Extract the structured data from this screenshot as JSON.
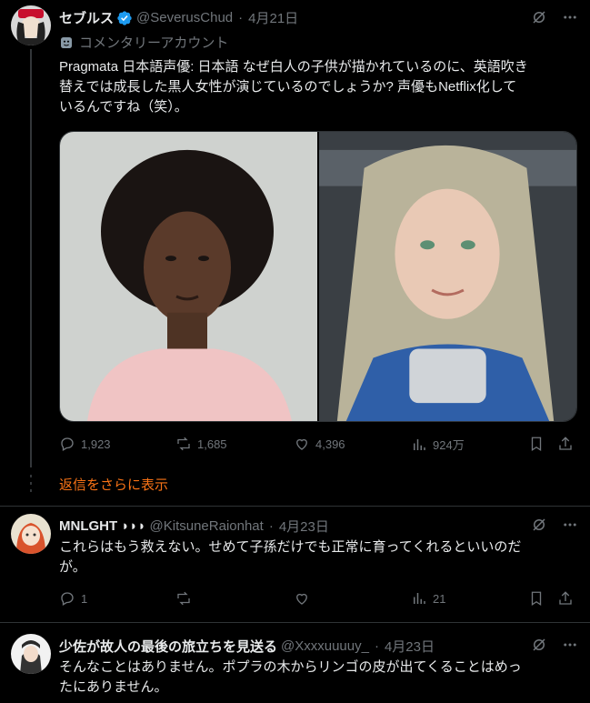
{
  "post1": {
    "name": "セブルス",
    "handle": "@SeverusChud",
    "date": "4月21日",
    "label": "コメンタリーアカウント",
    "text_line1": "Pragmata 日本語声優: 日本語 なぜ白人の子供が描かれているのに、英語吹き",
    "text_line2": "替えでは成長した黒人女性が演じているのでしょうか? 声優もNetflix化して",
    "text_line3": "いるんですね（笑）。",
    "replies": "1,923",
    "reposts": "1,685",
    "likes": "4,396",
    "views": "924万"
  },
  "show_more": "返信をさらに表示",
  "post2": {
    "name": "MNLGHT ◗◗◗",
    "handle": "@KitsuneRaionhat",
    "date": "4月23日",
    "text_line1": "これらはもう救えない。せめて子孫だけでも正常に育ってくれるといいのだ",
    "text_line2": "が。",
    "replies": "1",
    "reposts": "",
    "likes": "",
    "views": "21"
  },
  "post3": {
    "name": "少佐が故人の最後の旅立ちを見送る",
    "handle": "@Xxxxuuuuy_",
    "date": "4月23日",
    "text_line1": "そんなことはありません。ポプラの木からリンゴの皮が出てくることはめっ",
    "text_line2": "たにありません。"
  },
  "colors": {
    "background": "#000000",
    "text": "#e7e9ea",
    "muted": "#71767b",
    "verified": "#1d9bf0",
    "link": "#f97316"
  },
  "icons": [
    "grok-icon",
    "more-icon",
    "verified-icon",
    "reply-icon",
    "repost-icon",
    "like-icon",
    "views-icon",
    "bookmark-icon",
    "share-icon",
    "masks-icon"
  ]
}
